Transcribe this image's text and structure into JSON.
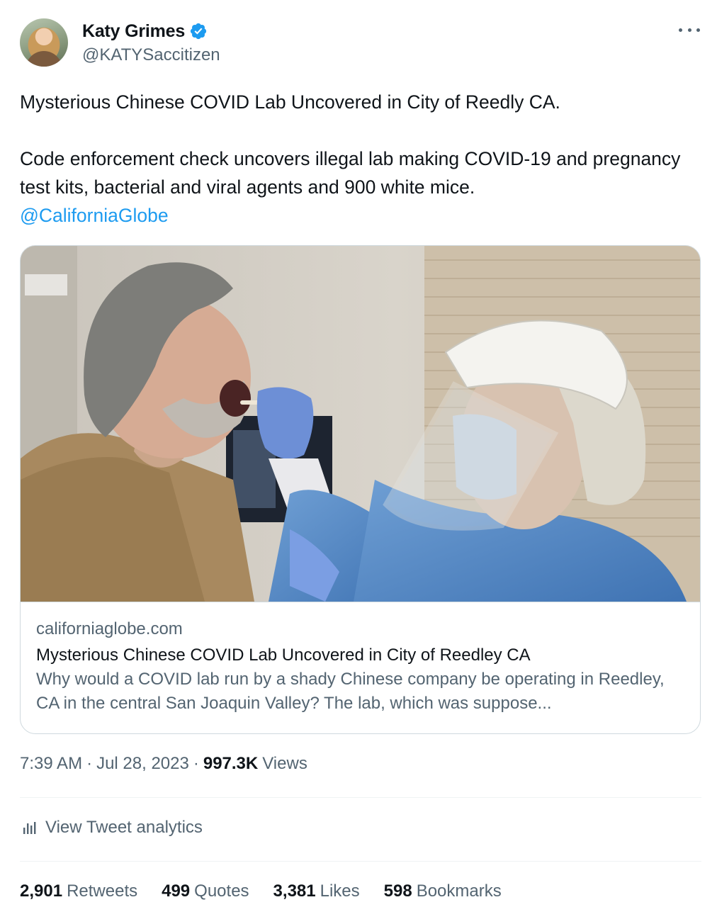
{
  "author": {
    "name": "Katy Grimes",
    "handle": "@KATYSaccitizen",
    "verified": true,
    "verified_color": "#1d9bf0"
  },
  "tweet": {
    "line1": "Mysterious Chinese COVID Lab Uncovered in City of Reedly CA.",
    "line2": "Code enforcement check uncovers illegal lab making COVID-19 and pregnancy test kits, bacterial and viral agents and 900 white mice.",
    "mention": "@CaliforniaGlobe"
  },
  "card": {
    "domain": "californiaglobe.com",
    "title": "Mysterious Chinese COVID Lab Uncovered in City of Reedley CA",
    "description": "Why would a COVID lab run by a shady Chinese company be operating in Reedley, CA in the central San Joaquin Valley? The lab, which was suppose..."
  },
  "meta": {
    "time": "7:39 AM",
    "date": "Jul 28, 2023",
    "views_count": "997.3K",
    "views_label": "Views",
    "separator": "·"
  },
  "analytics": {
    "label": "View Tweet analytics",
    "icon": "bar-chart-icon"
  },
  "stats": {
    "retweets_count": "2,901",
    "retweets_label": "Retweets",
    "quotes_count": "499",
    "quotes_label": "Quotes",
    "likes_count": "3,381",
    "likes_label": "Likes",
    "bookmarks_count": "598",
    "bookmarks_label": "Bookmarks"
  },
  "colors": {
    "text": "#0f1419",
    "secondary": "#536471",
    "link": "#1d9bf0",
    "border": "#cfd9de"
  }
}
